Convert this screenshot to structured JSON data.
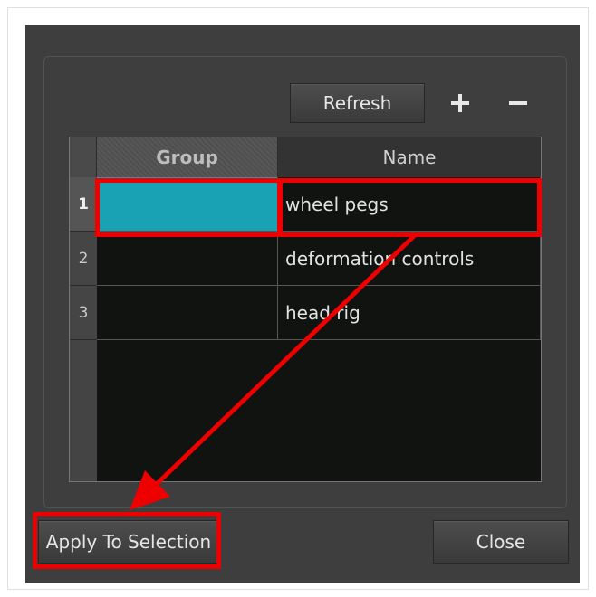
{
  "toolbar": {
    "refresh_label": "Refresh",
    "add_icon": "plus-icon",
    "remove_icon": "minus-icon"
  },
  "table": {
    "columns": [
      "Group",
      "Name"
    ],
    "rows": [
      {
        "number": "1",
        "group_color": "#19a2b4",
        "name": "wheel pegs",
        "selected": true
      },
      {
        "number": "2",
        "group_color": "",
        "name": "deformation controls",
        "selected": false
      },
      {
        "number": "3",
        "group_color": "",
        "name": "head rig",
        "selected": false
      }
    ]
  },
  "footer": {
    "apply_label": "Apply To Selection",
    "close_label": "Close"
  },
  "colors": {
    "dialog_bg": "#3e3e3e",
    "table_bg": "#111311",
    "selected_group": "#19a2b4",
    "annotation_red": "#ee0000"
  }
}
